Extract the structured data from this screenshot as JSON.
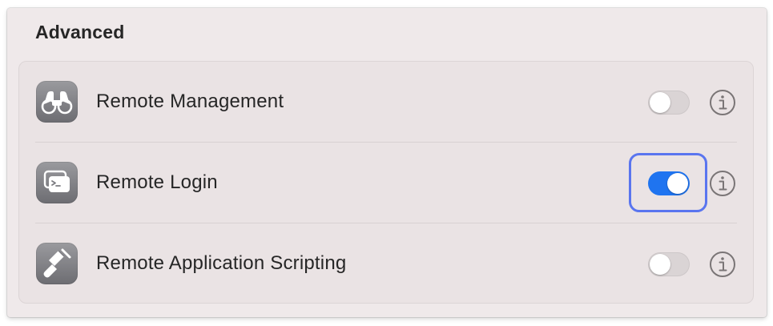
{
  "section": {
    "title": "Advanced"
  },
  "rows": [
    {
      "label": "Remote Management",
      "icon": "binoculars-icon",
      "toggle_on": false
    },
    {
      "label": "Remote Login",
      "icon": "terminal-windows-icon",
      "toggle_on": true
    },
    {
      "label": "Remote Application Scripting",
      "icon": "script-app-icon",
      "toggle_on": false
    }
  ],
  "colors": {
    "toggle_on": "#1f74f0",
    "toggle_off": "#dad4d5",
    "focus_ring": "#5a75ef"
  }
}
